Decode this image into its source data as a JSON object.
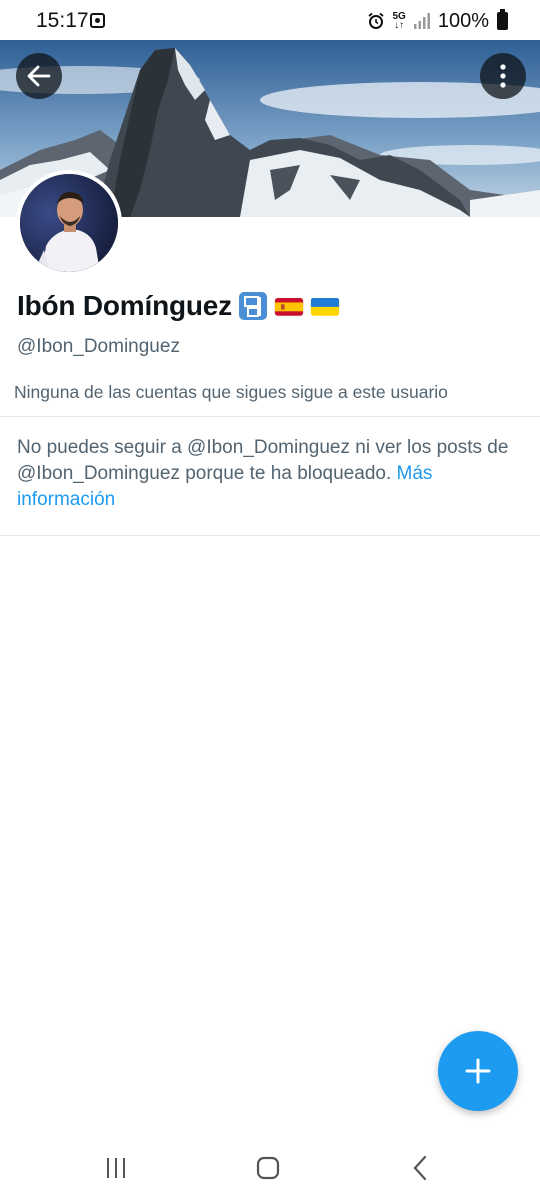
{
  "status_bar": {
    "time": "15:17",
    "network": "5G",
    "battery": "100%"
  },
  "profile": {
    "name": "Ibón Domínguez",
    "badges": [
      "transit-booth-emoji",
      "spain-flag-emoji",
      "ukraine-flag-emoji"
    ],
    "handle": "@Ibon_Dominguez",
    "followers_note": "Ninguna de las cuentas que sigues sigue a este usuario"
  },
  "blocked": {
    "message": "No puedes seguir a @Ibon_Dominguez ni ver los posts de @Ibon_Dominguez porque te ha bloqueado.",
    "link_label": "Más información"
  },
  "colors": {
    "accent": "#1d9bf0",
    "text_primary": "#0f1419",
    "text_secondary": "#536471",
    "divider": "#e3e7ea"
  },
  "icons": {
    "back": "arrow-left-icon",
    "more": "more-vertical-icon",
    "compose": "plus-icon",
    "nav_recents": "recents-icon",
    "nav_home": "home-icon",
    "nav_back": "chevron-left-icon"
  }
}
